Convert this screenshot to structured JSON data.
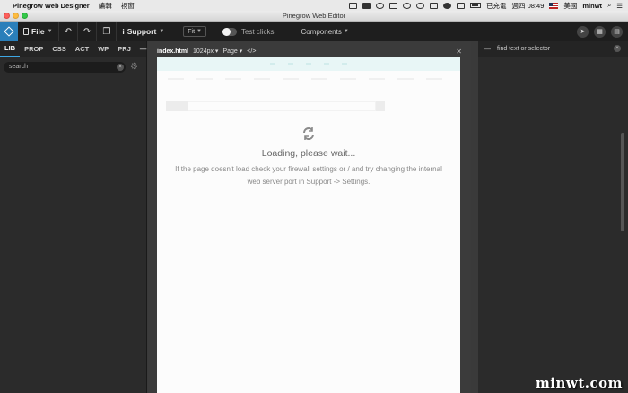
{
  "menubar": {
    "app_name": "Pinegrow Web Designer",
    "menus": [
      "編輯",
      "視窗"
    ],
    "battery_text": "已充電",
    "clock": "週四 08:49",
    "input_language": "美國",
    "user": "minwt"
  },
  "window": {
    "title": "Pinegrow Web Editor"
  },
  "toolbar": {
    "file_label": "File",
    "support_label": "Support",
    "fit_label": "Fit",
    "test_clicks_label": "Test clicks",
    "components_label": "Components"
  },
  "left_panel": {
    "tabs": [
      "LIB",
      "PROP",
      "CSS",
      "ACT",
      "WP",
      "PRJ",
      "—"
    ],
    "search_value": "search"
  },
  "document": {
    "file_name": "index.html",
    "width_label": "1024px",
    "page_label": "Page",
    "code_label": "</>",
    "loading_title": "Loading, please wait...",
    "loading_message": "If the page doesn't load check your firewall settings or / and try changing the internal web server port in Support -> Settings."
  },
  "right_panel": {
    "dash": "—",
    "search_placeholder": "find text or selector"
  },
  "watermark": "minwt.com",
  "colors": {
    "accent": "#3ea8e5",
    "logo_bg": "#2a7fba"
  }
}
